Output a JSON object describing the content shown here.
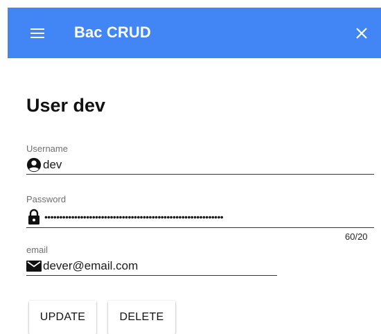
{
  "app_bar": {
    "title": "Bac CRUD",
    "background": "#4285f4",
    "menu_icon": "menu-icon",
    "close_icon": "close-icon"
  },
  "page": {
    "title": "User dev"
  },
  "form": {
    "username": {
      "label": "Username",
      "value": "dev",
      "icon": "account-circle-icon"
    },
    "password": {
      "label": "Password",
      "masked_value": "••••••••••••••••••••••••••••••••••••••••••••••••••••••••••••",
      "icon": "lock-icon",
      "counter": "60/20"
    },
    "email": {
      "label": "email",
      "value": "dever@email.com",
      "icon": "email-icon"
    }
  },
  "actions": {
    "update_label": "UPDATE",
    "delete_label": "DELETE"
  }
}
